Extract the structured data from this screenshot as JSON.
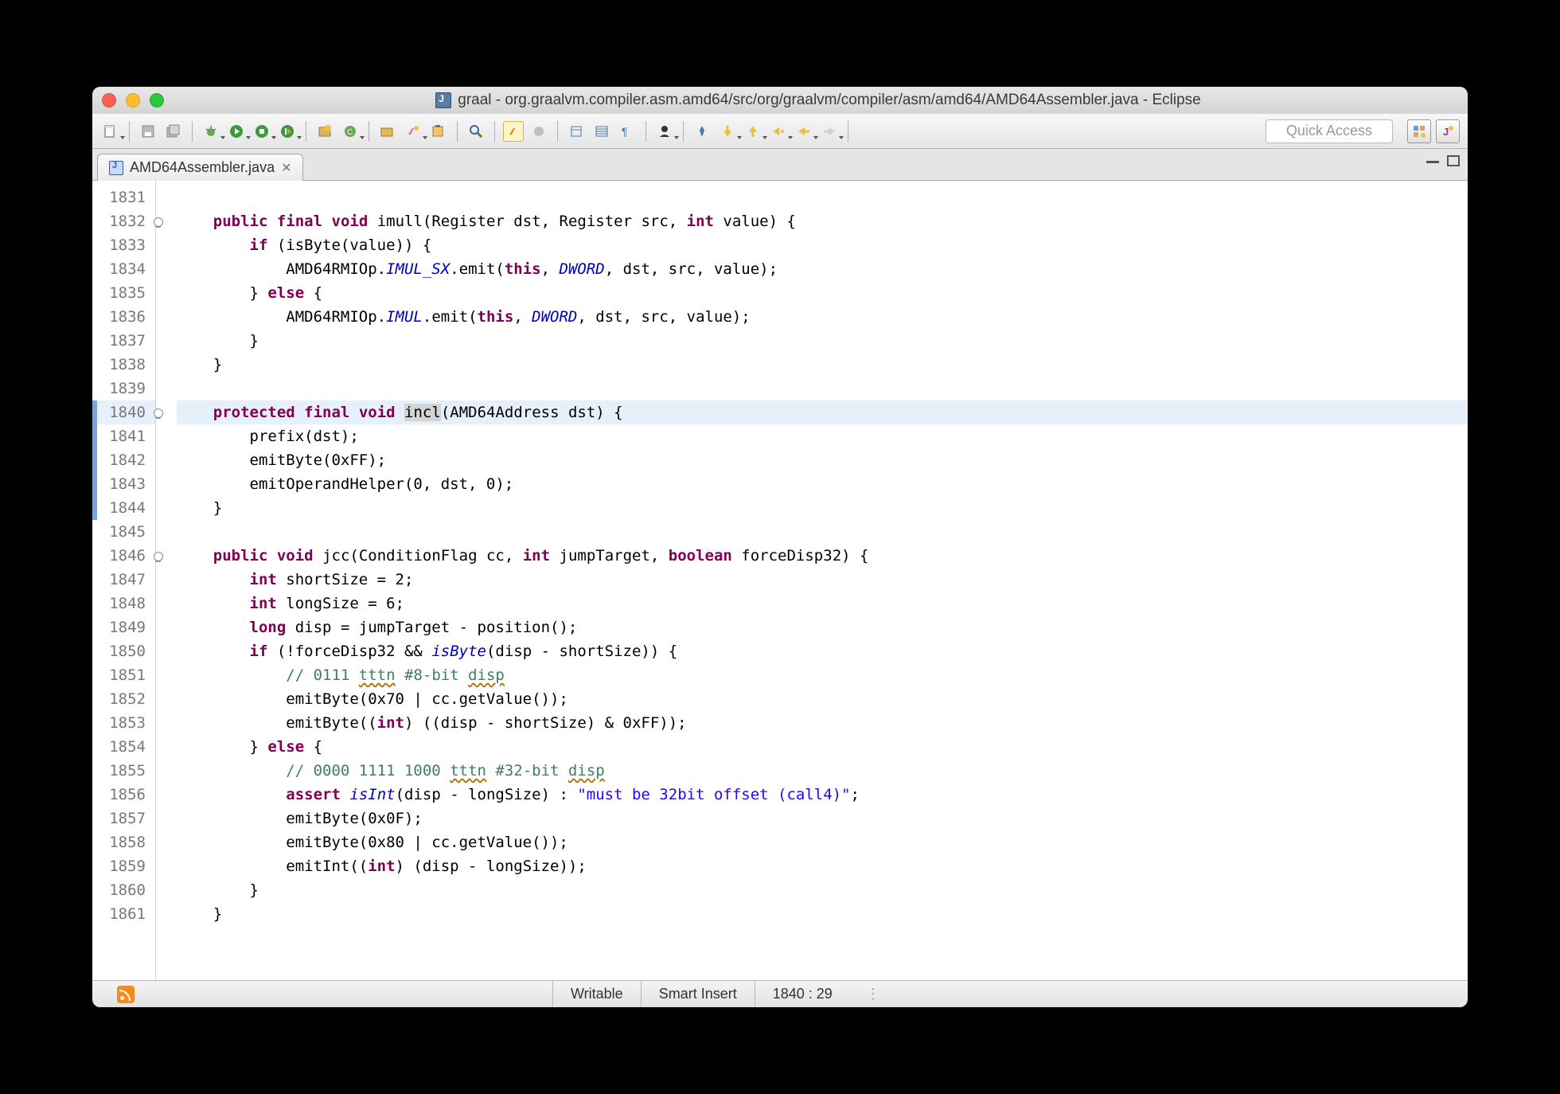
{
  "window": {
    "title": "graal - org.graalvm.compiler.asm.amd64/src/org/graalvm/compiler/asm/amd64/AMD64Assembler.java - Eclipse"
  },
  "toolbar": {
    "quick_access_placeholder": "Quick Access"
  },
  "tab": {
    "filename": "AMD64Assembler.java",
    "close": "✕"
  },
  "gutter": {
    "start": 1831,
    "end": 1861,
    "fold_lines": [
      1832,
      1840,
      1846
    ],
    "highlighted": [
      1840
    ],
    "bluebar": [
      1840,
      1841,
      1842,
      1843,
      1844
    ]
  },
  "code": {
    "lines": [
      {
        "n": 1831,
        "t": ""
      },
      {
        "n": 1832,
        "t": "    <kw>public</kw> <kw>final</kw> <kw>void</kw> imull(Register dst, Register src, <kw>int</kw> value) {"
      },
      {
        "n": 1833,
        "t": "        <kw>if</kw> (isByte(value)) {"
      },
      {
        "n": 1834,
        "t": "            AMD64RMIOp.<staticf>IMUL_SX</staticf>.emit(<kw>this</kw>, <staticf>DWORD</staticf>, dst, src, value);"
      },
      {
        "n": 1835,
        "t": "        } <kw>else</kw> {"
      },
      {
        "n": 1836,
        "t": "            AMD64RMIOp.<staticf>IMUL</staticf>.emit(<kw>this</kw>, <staticf>DWORD</staticf>, dst, src, value);"
      },
      {
        "n": 1837,
        "t": "        }"
      },
      {
        "n": 1838,
        "t": "    }"
      },
      {
        "n": 1839,
        "t": ""
      },
      {
        "n": 1840,
        "t": "    <kw>protected</kw> <kw>final</kw> <kw>void</kw> <sel>incl</sel>(AMD64Address dst) {",
        "hl": true
      },
      {
        "n": 1841,
        "t": "        prefix(dst);"
      },
      {
        "n": 1842,
        "t": "        emitByte(0xFF);"
      },
      {
        "n": 1843,
        "t": "        emitOperandHelper(0, dst, 0);"
      },
      {
        "n": 1844,
        "t": "    }"
      },
      {
        "n": 1845,
        "t": ""
      },
      {
        "n": 1846,
        "t": "    <kw>public</kw> <kw>void</kw> jcc(ConditionFlag cc, <kw>int</kw> jumpTarget, <kw>boolean</kw> forceDisp32) {"
      },
      {
        "n": 1847,
        "t": "        <kw>int</kw> shortSize = 2;"
      },
      {
        "n": 1848,
        "t": "        <kw>int</kw> longSize = 6;"
      },
      {
        "n": 1849,
        "t": "        <kw>long</kw> disp = jumpTarget - position();"
      },
      {
        "n": 1850,
        "t": "        <kw>if</kw> (!forceDisp32 && <staticf>isByte</staticf>(disp - shortSize)) {"
      },
      {
        "n": 1851,
        "t": "            <comment>// 0111 <spell>tttn</spell> #8-bit <spell>disp</spell></comment>"
      },
      {
        "n": 1852,
        "t": "            emitByte(0x70 | cc.getValue());"
      },
      {
        "n": 1853,
        "t": "            emitByte((<kw>int</kw>) ((disp - shortSize) & 0xFF));"
      },
      {
        "n": 1854,
        "t": "        } <kw>else</kw> {"
      },
      {
        "n": 1855,
        "t": "            <comment>// 0000 1111 1000 <spell>tttn</spell> #32-bit <spell>disp</spell></comment>"
      },
      {
        "n": 1856,
        "t": "            <kw>assert</kw> <staticf>isInt</staticf>(disp - longSize) : <str>\"must be 32bit offset (call4)\"</str>;"
      },
      {
        "n": 1857,
        "t": "            emitByte(0x0F);"
      },
      {
        "n": 1858,
        "t": "            emitByte(0x80 | cc.getValue());"
      },
      {
        "n": 1859,
        "t": "            emitInt((<kw>int</kw>) (disp - longSize));"
      },
      {
        "n": 1860,
        "t": "        }"
      },
      {
        "n": 1861,
        "t": "    }"
      }
    ]
  },
  "status": {
    "writable": "Writable",
    "insert": "Smart Insert",
    "pos": "1840 : 29"
  },
  "toolbar_icons": [
    "new-wizard",
    "save",
    "save-all",
    "|",
    "debug",
    "run",
    "coverage",
    "run-ext",
    "|",
    "new-package",
    "new-class",
    "|",
    "open-type",
    "open-task",
    "task-list",
    "|",
    "search",
    "|",
    "toggle-mark",
    "toggle-breadcrumb",
    "|",
    "outline",
    "show-whitespace",
    "block-select",
    "|",
    "annotation",
    "|",
    "pin",
    "prev-ann",
    "next-ann",
    "back",
    "forward",
    "|"
  ]
}
